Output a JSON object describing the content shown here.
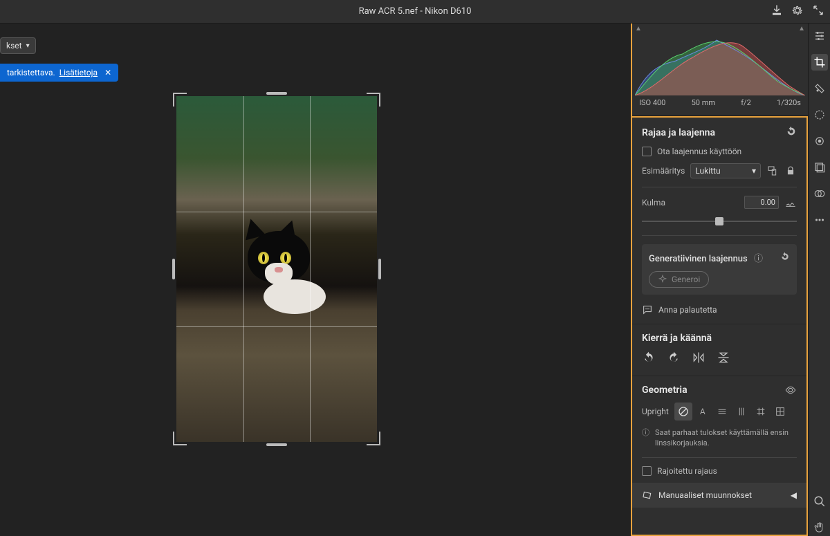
{
  "topbar": {
    "filename": "Raw ACR 5.nef",
    "separator": "  -  ",
    "camera": "Nikon D610"
  },
  "stage": {
    "chip_label": "kset",
    "banner_text": "tarkistettava.",
    "banner_link": "Lisätietoja"
  },
  "histogram": {
    "iso": "ISO 400",
    "focal": "50 mm",
    "aperture": "f/2",
    "shutter": "1/320s"
  },
  "panels": {
    "crop": {
      "title": "Rajaa ja laajenna",
      "enable_expand": "Ota laajennus käyttöön",
      "preset_label": "Esimääritys",
      "preset_value": "Lukittu",
      "angle_label": "Kulma",
      "angle_value": "0.00"
    },
    "gen": {
      "title": "Generatiivinen laajennus",
      "button": "Generoi",
      "feedback": "Anna palautetta"
    },
    "rotate": {
      "title": "Kierrä ja käännä"
    },
    "geometry": {
      "title": "Geometria",
      "upright_label": "Upright",
      "tip": "Saat parhaat tulokset käyttämällä ensin linssikorjauksia.",
      "constrain": "Rajoitettu rajaus",
      "manual": "Manuaaliset muunnokset"
    }
  }
}
